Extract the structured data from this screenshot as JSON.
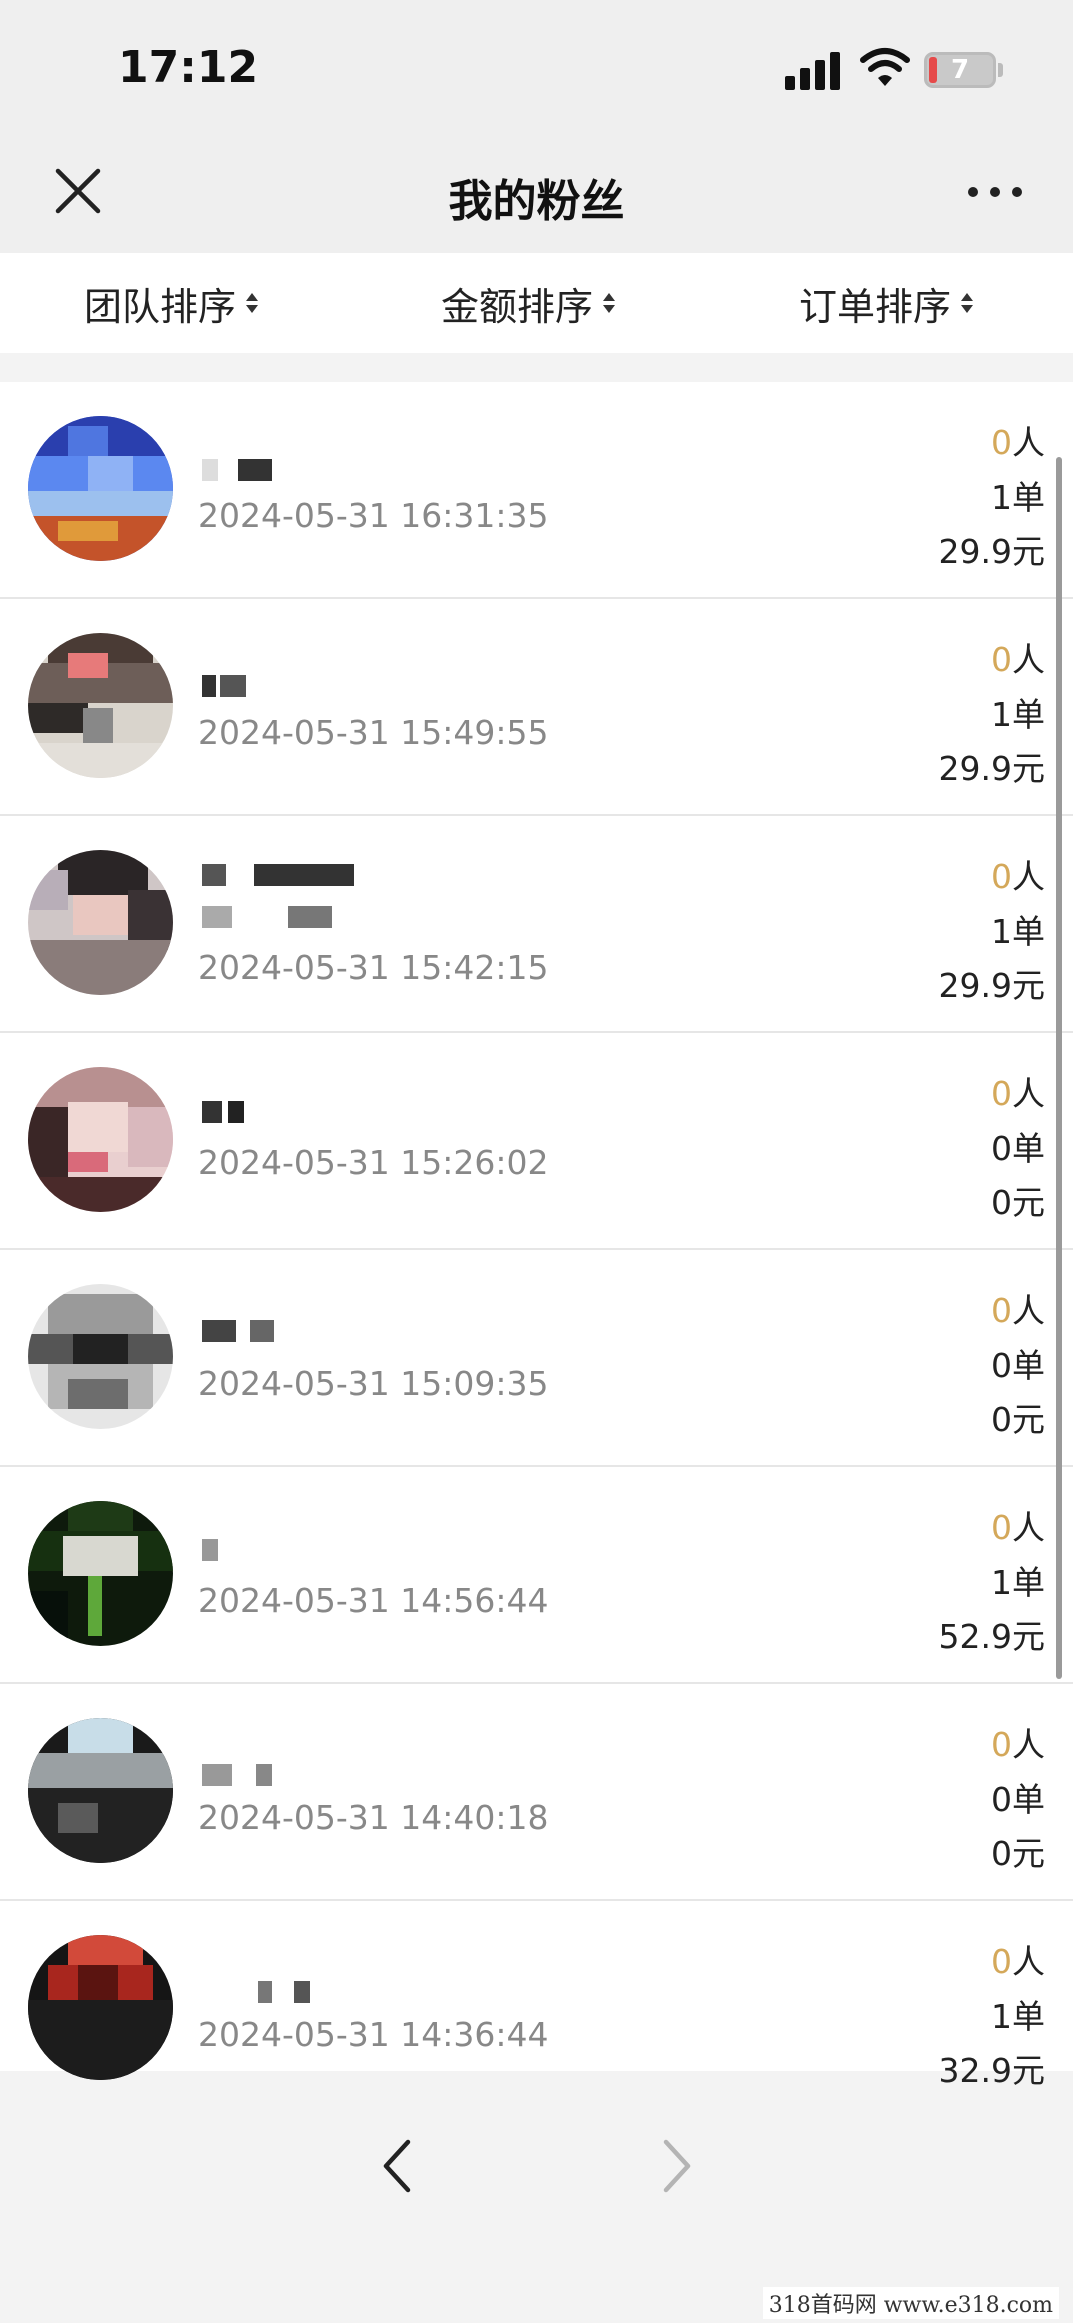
{
  "status_bar": {
    "time": "17:12",
    "battery": "7"
  },
  "nav": {
    "title": "我的粉丝"
  },
  "sort": [
    {
      "label": "团队排序"
    },
    {
      "label": "金额排序"
    },
    {
      "label": "订单排序"
    }
  ],
  "fans": [
    {
      "time": "2024-05-31 16:31:35",
      "count": "0",
      "count_unit": "人",
      "orders": "1单",
      "amount": "29.9元"
    },
    {
      "time": "2024-05-31 15:49:55",
      "count": "0",
      "count_unit": "人",
      "orders": "1单",
      "amount": "29.9元"
    },
    {
      "time": "2024-05-31 15:42:15",
      "count": "0",
      "count_unit": "人",
      "orders": "1单",
      "amount": "29.9元"
    },
    {
      "time": "2024-05-31 15:26:02",
      "count": "0",
      "count_unit": "人",
      "orders": "0单",
      "amount": "0元"
    },
    {
      "time": "2024-05-31 15:09:35",
      "count": "0",
      "count_unit": "人",
      "orders": "0单",
      "amount": "0元"
    },
    {
      "time": "2024-05-31 14:56:44",
      "count": "0",
      "count_unit": "人",
      "orders": "1单",
      "amount": "52.9元"
    },
    {
      "time": "2024-05-31 14:40:18",
      "count": "0",
      "count_unit": "人",
      "orders": "0单",
      "amount": "0元"
    },
    {
      "time": "2024-05-31 14:36:44",
      "count": "0",
      "count_unit": "人",
      "orders": "1单",
      "amount": "32.9元"
    }
  ],
  "watermark": "318首码网  www.e318.com",
  "colors": {
    "accent": "#d4a85a",
    "time_text": "#888888",
    "background": "#f3f3f3"
  },
  "icons": {
    "close": "close-icon",
    "more": "more-icon",
    "back": "chevron-left-icon",
    "forward": "chevron-right-icon"
  }
}
